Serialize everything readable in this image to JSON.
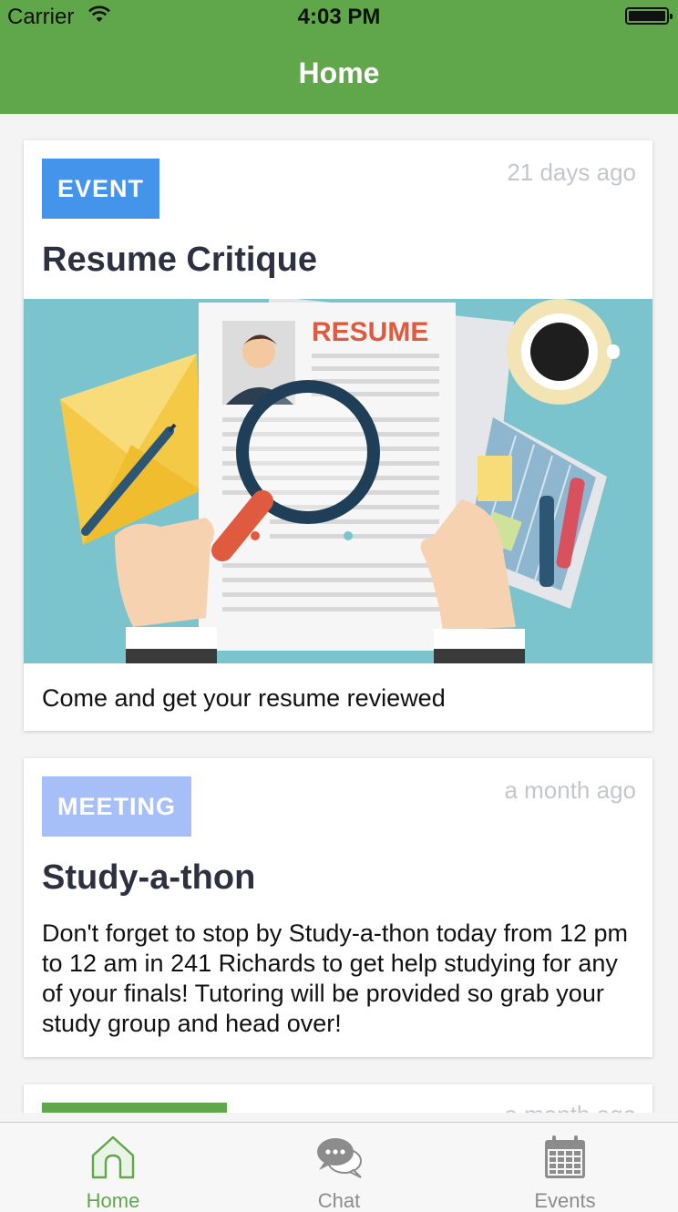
{
  "status_bar": {
    "carrier": "Carrier",
    "time": "4:03 PM",
    "battery_level": 1.0
  },
  "nav": {
    "title": "Home"
  },
  "feed": {
    "items": [
      {
        "badge": "EVENT",
        "badge_color": "#4394ea",
        "time_ago": "21 days ago",
        "title": "Resume Critique",
        "image": {
          "heading": "RESUME"
        },
        "description": "Come and get your resume reviewed"
      },
      {
        "badge": "MEETING",
        "badge_color": "#a6bff9",
        "time_ago": "a month ago",
        "title": "Study-a-thon",
        "description": "Don't forget to stop by Study-a-thon today from 12 pm to 12 am in 241 Richards to get help studying for any of your finals! Tutoring will be provided so grab your study group and head over!"
      },
      {
        "badge_color": "#60a64b",
        "time_ago": "a month ago"
      }
    ]
  },
  "tab_bar": {
    "active": "Home",
    "tabs": [
      {
        "label": "Home",
        "icon": "home-icon"
      },
      {
        "label": "Chat",
        "icon": "chat-icon"
      },
      {
        "label": "Events",
        "icon": "calendar-icon"
      }
    ]
  },
  "colors": {
    "brand_green": "#60a64b",
    "event_blue": "#4394ea",
    "meeting_blue": "#a6bff9",
    "hero_teal": "#7bc4cd"
  }
}
